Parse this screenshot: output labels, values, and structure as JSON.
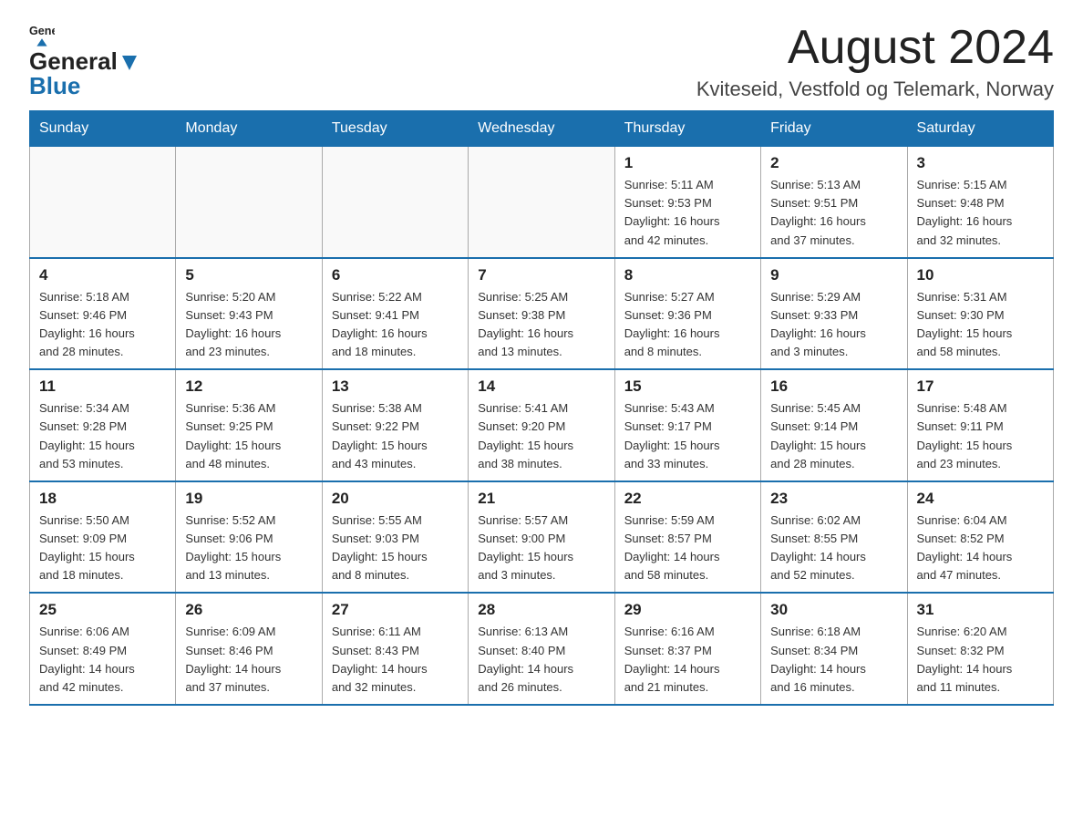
{
  "header": {
    "logo_general": "General",
    "logo_blue": "Blue",
    "month_year": "August 2024",
    "location": "Kviteseid, Vestfold og Telemark, Norway"
  },
  "days_of_week": [
    "Sunday",
    "Monday",
    "Tuesday",
    "Wednesday",
    "Thursday",
    "Friday",
    "Saturday"
  ],
  "weeks": [
    [
      {
        "day": "",
        "info": ""
      },
      {
        "day": "",
        "info": ""
      },
      {
        "day": "",
        "info": ""
      },
      {
        "day": "",
        "info": ""
      },
      {
        "day": "1",
        "info": "Sunrise: 5:11 AM\nSunset: 9:53 PM\nDaylight: 16 hours\nand 42 minutes."
      },
      {
        "day": "2",
        "info": "Sunrise: 5:13 AM\nSunset: 9:51 PM\nDaylight: 16 hours\nand 37 minutes."
      },
      {
        "day": "3",
        "info": "Sunrise: 5:15 AM\nSunset: 9:48 PM\nDaylight: 16 hours\nand 32 minutes."
      }
    ],
    [
      {
        "day": "4",
        "info": "Sunrise: 5:18 AM\nSunset: 9:46 PM\nDaylight: 16 hours\nand 28 minutes."
      },
      {
        "day": "5",
        "info": "Sunrise: 5:20 AM\nSunset: 9:43 PM\nDaylight: 16 hours\nand 23 minutes."
      },
      {
        "day": "6",
        "info": "Sunrise: 5:22 AM\nSunset: 9:41 PM\nDaylight: 16 hours\nand 18 minutes."
      },
      {
        "day": "7",
        "info": "Sunrise: 5:25 AM\nSunset: 9:38 PM\nDaylight: 16 hours\nand 13 minutes."
      },
      {
        "day": "8",
        "info": "Sunrise: 5:27 AM\nSunset: 9:36 PM\nDaylight: 16 hours\nand 8 minutes."
      },
      {
        "day": "9",
        "info": "Sunrise: 5:29 AM\nSunset: 9:33 PM\nDaylight: 16 hours\nand 3 minutes."
      },
      {
        "day": "10",
        "info": "Sunrise: 5:31 AM\nSunset: 9:30 PM\nDaylight: 15 hours\nand 58 minutes."
      }
    ],
    [
      {
        "day": "11",
        "info": "Sunrise: 5:34 AM\nSunset: 9:28 PM\nDaylight: 15 hours\nand 53 minutes."
      },
      {
        "day": "12",
        "info": "Sunrise: 5:36 AM\nSunset: 9:25 PM\nDaylight: 15 hours\nand 48 minutes."
      },
      {
        "day": "13",
        "info": "Sunrise: 5:38 AM\nSunset: 9:22 PM\nDaylight: 15 hours\nand 43 minutes."
      },
      {
        "day": "14",
        "info": "Sunrise: 5:41 AM\nSunset: 9:20 PM\nDaylight: 15 hours\nand 38 minutes."
      },
      {
        "day": "15",
        "info": "Sunrise: 5:43 AM\nSunset: 9:17 PM\nDaylight: 15 hours\nand 33 minutes."
      },
      {
        "day": "16",
        "info": "Sunrise: 5:45 AM\nSunset: 9:14 PM\nDaylight: 15 hours\nand 28 minutes."
      },
      {
        "day": "17",
        "info": "Sunrise: 5:48 AM\nSunset: 9:11 PM\nDaylight: 15 hours\nand 23 minutes."
      }
    ],
    [
      {
        "day": "18",
        "info": "Sunrise: 5:50 AM\nSunset: 9:09 PM\nDaylight: 15 hours\nand 18 minutes."
      },
      {
        "day": "19",
        "info": "Sunrise: 5:52 AM\nSunset: 9:06 PM\nDaylight: 15 hours\nand 13 minutes."
      },
      {
        "day": "20",
        "info": "Sunrise: 5:55 AM\nSunset: 9:03 PM\nDaylight: 15 hours\nand 8 minutes."
      },
      {
        "day": "21",
        "info": "Sunrise: 5:57 AM\nSunset: 9:00 PM\nDaylight: 15 hours\nand 3 minutes."
      },
      {
        "day": "22",
        "info": "Sunrise: 5:59 AM\nSunset: 8:57 PM\nDaylight: 14 hours\nand 58 minutes."
      },
      {
        "day": "23",
        "info": "Sunrise: 6:02 AM\nSunset: 8:55 PM\nDaylight: 14 hours\nand 52 minutes."
      },
      {
        "day": "24",
        "info": "Sunrise: 6:04 AM\nSunset: 8:52 PM\nDaylight: 14 hours\nand 47 minutes."
      }
    ],
    [
      {
        "day": "25",
        "info": "Sunrise: 6:06 AM\nSunset: 8:49 PM\nDaylight: 14 hours\nand 42 minutes."
      },
      {
        "day": "26",
        "info": "Sunrise: 6:09 AM\nSunset: 8:46 PM\nDaylight: 14 hours\nand 37 minutes."
      },
      {
        "day": "27",
        "info": "Sunrise: 6:11 AM\nSunset: 8:43 PM\nDaylight: 14 hours\nand 32 minutes."
      },
      {
        "day": "28",
        "info": "Sunrise: 6:13 AM\nSunset: 8:40 PM\nDaylight: 14 hours\nand 26 minutes."
      },
      {
        "day": "29",
        "info": "Sunrise: 6:16 AM\nSunset: 8:37 PM\nDaylight: 14 hours\nand 21 minutes."
      },
      {
        "day": "30",
        "info": "Sunrise: 6:18 AM\nSunset: 8:34 PM\nDaylight: 14 hours\nand 16 minutes."
      },
      {
        "day": "31",
        "info": "Sunrise: 6:20 AM\nSunset: 8:32 PM\nDaylight: 14 hours\nand 11 minutes."
      }
    ]
  ]
}
